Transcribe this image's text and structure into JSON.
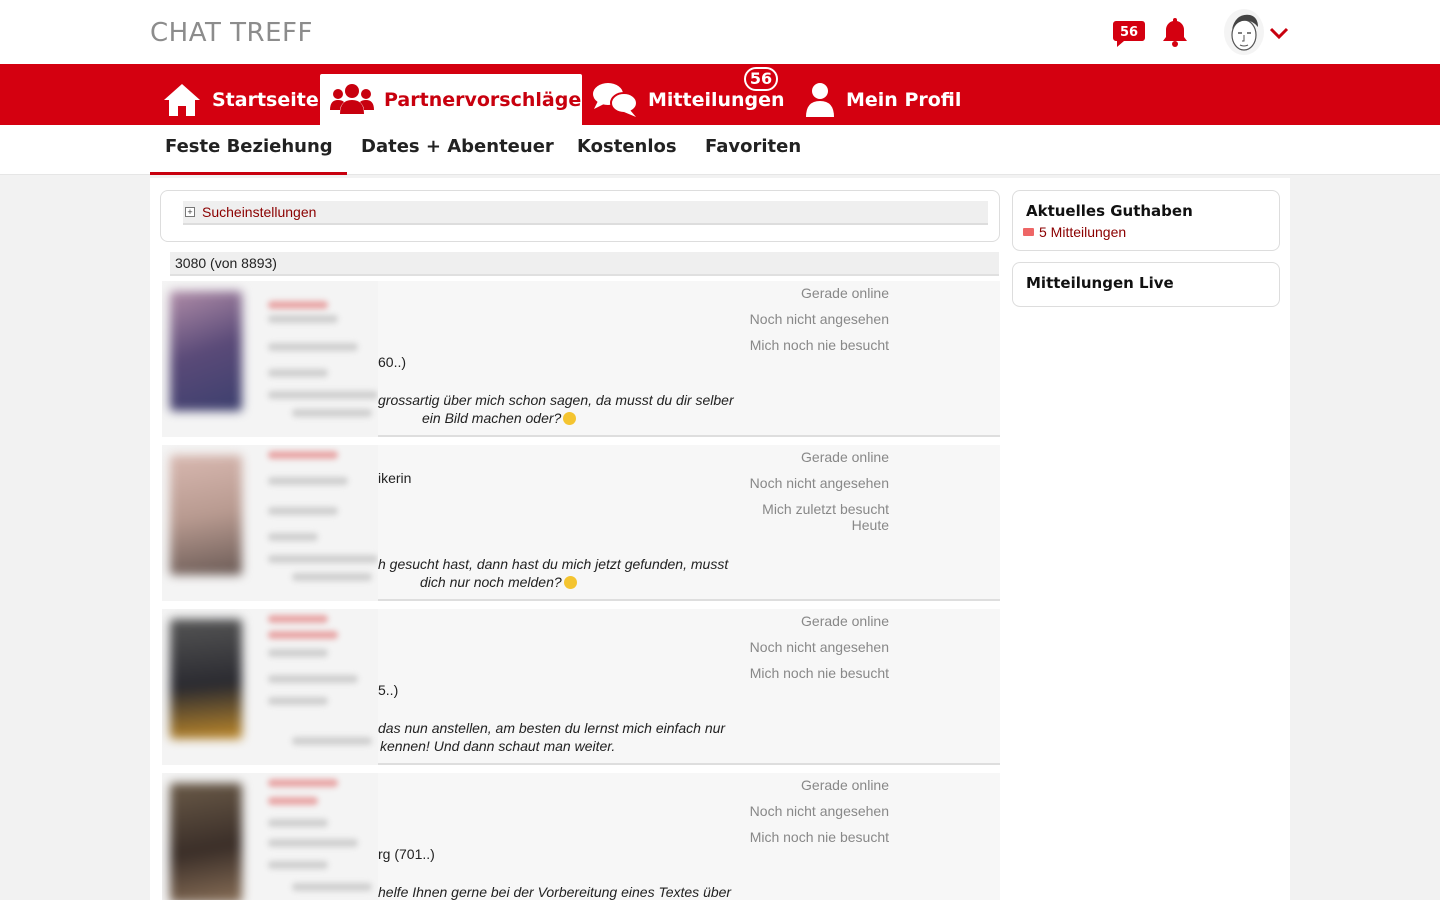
{
  "header": {
    "logo": "CHAT TREFF",
    "chat_badge": "56",
    "message_badge": "56"
  },
  "nav": {
    "items": [
      {
        "label": "Startseite",
        "icon": "home-icon"
      },
      {
        "label": "Partnervorschläge",
        "icon": "users-icon",
        "active": true
      },
      {
        "label": "Mitteilungen",
        "icon": "chat-bubbles-icon"
      },
      {
        "label": "Mein Profil",
        "icon": "user-icon"
      }
    ]
  },
  "subnav": {
    "items": [
      "Feste Beziehung",
      "Dates + Abenteuer",
      "Kostenlos",
      "Favoriten"
    ],
    "active": "Feste Beziehung"
  },
  "search": {
    "label": "Sucheinstellungen"
  },
  "results": {
    "count": "3080 (von 8893)"
  },
  "profiles": [
    {
      "fragments": [
        "60..)"
      ],
      "quote": [
        "grossartig über mich schon sagen, da musst du dir selber",
        "ein Bild machen oder?"
      ],
      "status": [
        "Gerade online",
        "Noch nicht angesehen",
        "Mich noch nie besucht"
      ]
    },
    {
      "fragments": [
        "ikerin"
      ],
      "quote": [
        "h gesucht hast, dann hast du mich jetzt gefunden, musst",
        "dich nur noch melden?"
      ],
      "status": [
        "Gerade online",
        "Noch nicht angesehen",
        "Mich zuletzt besucht",
        "Heute"
      ]
    },
    {
      "fragments": [
        "5..)"
      ],
      "quote": [
        "das nun anstellen, am besten du lernst mich einfach nur",
        "kennen! Und dann schaut man weiter."
      ],
      "status": [
        "Gerade online",
        "Noch nicht angesehen",
        "Mich noch nie besucht"
      ]
    },
    {
      "fragments": [
        "rg (701..)"
      ],
      "quote": [
        "helfe Ihnen gerne bei der Vorbereitung eines Textes über",
        ""
      ],
      "status": [
        "Gerade online",
        "Noch nicht angesehen",
        "Mich noch nie besucht"
      ]
    }
  ],
  "sidebar": {
    "balance": {
      "title": "Aktuelles Guthaben",
      "link": "5 Mitteilungen"
    },
    "live": {
      "title": "Mitteilungen Live"
    }
  },
  "colors": {
    "brand": "#d40010",
    "link": "#8b0000"
  }
}
